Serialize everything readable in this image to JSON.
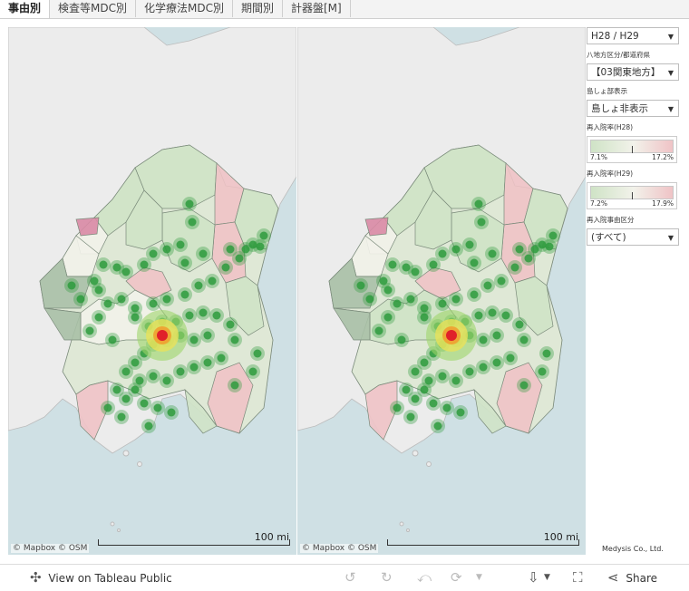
{
  "tabs": [
    {
      "label": "事由別",
      "active": true
    },
    {
      "label": "検査等MDC別",
      "active": false
    },
    {
      "label": "化学療法MDC別",
      "active": false
    },
    {
      "label": "期間別",
      "active": false
    },
    {
      "label": "計器盤[M]",
      "active": false
    }
  ],
  "maps": {
    "attribution": "© Mapbox  © OSM",
    "scale_label": "100 mi"
  },
  "filters": {
    "period": {
      "value": "H28 / H29"
    },
    "region": {
      "label": "八地方区分/都道府県",
      "value": "【03関東地方】"
    },
    "island": {
      "label": "島しょ部表示",
      "value": "島しょ非表示"
    },
    "legend_h28": {
      "label": "再入院率(H28)",
      "min": "7.1%",
      "max": "17.2%"
    },
    "legend_h29": {
      "label": "再入院率(H29)",
      "min": "7.2%",
      "max": "17.9%"
    },
    "reason": {
      "label": "再入院事由区分",
      "value": "(すべて)"
    }
  },
  "company": "Medysis Co., Ltd.",
  "toolbar": {
    "view_label": "View on Tableau Public",
    "share_label": "Share"
  },
  "colors": {
    "low": "#cfe3c6",
    "mid": "#f2f2ea",
    "high": "#efc3c6",
    "hotspot": "#2e9b3d",
    "peak": "#e0202a"
  }
}
